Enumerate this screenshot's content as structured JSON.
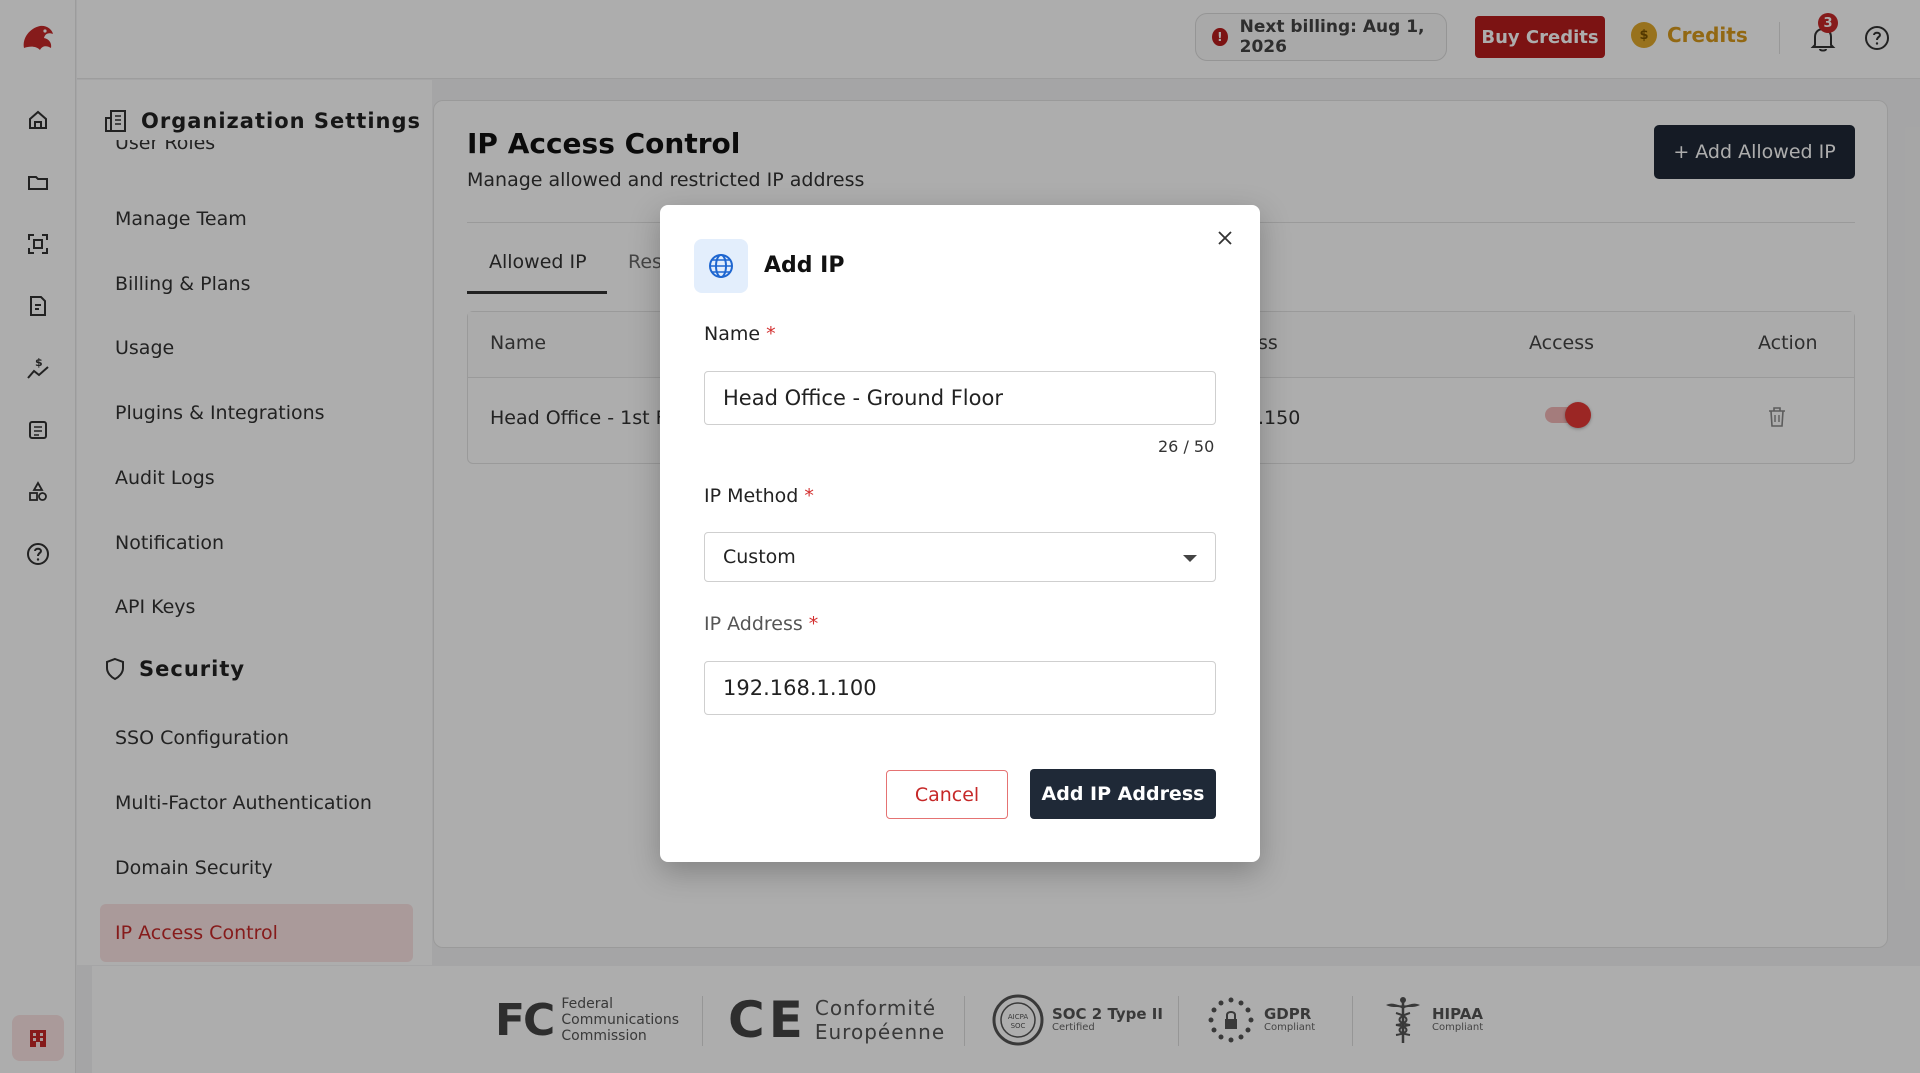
{
  "header": {
    "billing_text": "Next billing: Aug 1, 2026",
    "buy_credits": "Buy Credits",
    "credits_label": "Credits",
    "coin_symbol": "$",
    "notification_count": "3",
    "info_symbol": "!"
  },
  "sidebar": {
    "org_title": "Organization Settings",
    "partial_item": "User Roles",
    "items": [
      "Manage Team",
      "Billing & Plans",
      "Usage",
      "Plugins & Integrations",
      "Audit Logs",
      "Notification",
      "API Keys"
    ],
    "security_title": "Security",
    "security_items": [
      "SSO Configuration",
      "Multi-Factor Authentication",
      "Domain Security"
    ],
    "active_item": "IP Access Control"
  },
  "main": {
    "title": "IP Access Control",
    "subtitle": "Manage allowed and restricted IP address",
    "add_button": "+ Add Allowed IP",
    "tabs": [
      "Allowed IP",
      "Res"
    ],
    "columns": {
      "name": "Name",
      "address": "ss",
      "access": "Access",
      "action": "Action"
    },
    "rows": [
      {
        "name": "Head Office - 1st F",
        "address": ".150",
        "access_enabled": true
      }
    ]
  },
  "modal": {
    "title": "Add IP",
    "name_label": "Name",
    "name_value": "Head Office - Ground Floor",
    "name_counter": "26 / 50",
    "method_label": "IP Method",
    "method_value": "Custom",
    "address_label": "IP Address",
    "address_value": "192.168.1.100",
    "required_mark": "*",
    "cancel": "Cancel",
    "submit": "Add IP Address"
  },
  "footer": {
    "fcc_logo": "FC",
    "fcc_lines": [
      "Federal",
      "Communications",
      "Commission"
    ],
    "ce_logo": "CE",
    "ce_lines": [
      "Conformité",
      "Européenne"
    ],
    "soc_seal": "AICPA SOC",
    "soc_title": "SOC 2 Type II",
    "soc_sub": "Certified",
    "gdpr_title": "GDPR",
    "gdpr_sub": "Compliant",
    "hipaa_title": "HIPAA",
    "hipaa_sub": "Compliant"
  },
  "colors": {
    "brand_red": "#b71c1c",
    "dark_button": "#1f2937",
    "active_bg": "#fbe3e3",
    "coin": "#e0a92b"
  }
}
